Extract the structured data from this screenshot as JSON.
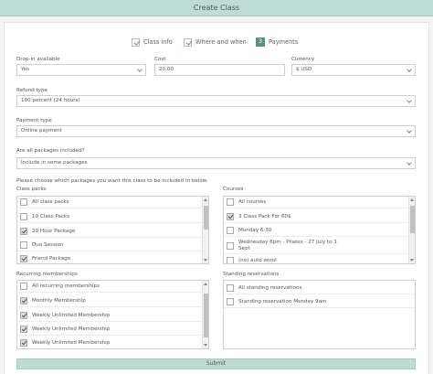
{
  "title": "Create Class",
  "steps": {
    "class_info": "Class info",
    "where_when": "Where and when",
    "payments_num": "3",
    "payments": "Payments"
  },
  "dropin": {
    "label": "Drop-in available",
    "value": "Yes"
  },
  "cost": {
    "label": "Cost",
    "value": "20.00"
  },
  "currency": {
    "label": "Currency",
    "value": "$ USD"
  },
  "refund": {
    "label": "Refund type",
    "value": "100 percent (24 hours)"
  },
  "payment_type": {
    "label": "Payment type",
    "value": "Online payment"
  },
  "packages_included": {
    "label": "Are all packages included?",
    "value": "Include in some packages"
  },
  "choose_text": "Please choose which packages you want this class to be included in below.",
  "class_packs": {
    "label": "Class packs",
    "items": [
      {
        "text": "All class packs",
        "checked": false
      },
      {
        "text": "10 Class Packs",
        "checked": false
      },
      {
        "text": "20 Hour Package",
        "checked": true
      },
      {
        "text": "Duo Session",
        "checked": false
      },
      {
        "text": "Friend Package",
        "checked": true
      }
    ]
  },
  "courses": {
    "label": "Courses",
    "items": [
      {
        "text": "All courses",
        "checked": false
      },
      {
        "text": "3 Class Pack For 60$",
        "checked": true
      },
      {
        "text": "Monday 6:30",
        "checked": false
      },
      {
        "text": "Wednesday 8pm - Pilates - 27 July to 1 Sept",
        "checked": false
      },
      {
        "text": "(no) auto enrol",
        "checked": false
      }
    ]
  },
  "recurring": {
    "label": "Recurring memberships",
    "items": [
      {
        "text": "All recurring memberships",
        "checked": false
      },
      {
        "text": "Monthly Membership",
        "checked": true
      },
      {
        "text": "Weekly Unlimited Membership",
        "checked": true
      },
      {
        "text": "Weekly Unlimited Membership",
        "checked": true
      },
      {
        "text": "Weekly Unlimited Membership",
        "checked": true
      }
    ]
  },
  "standing": {
    "label": "Standing reservations",
    "items": [
      {
        "text": "All standing reservations",
        "checked": false
      },
      {
        "text": "Standing reservation Monday 9am",
        "checked": false
      }
    ]
  },
  "submit": "Submit",
  "colors": {
    "header": "#bfdcd4",
    "step_active": "#5b8f85"
  }
}
